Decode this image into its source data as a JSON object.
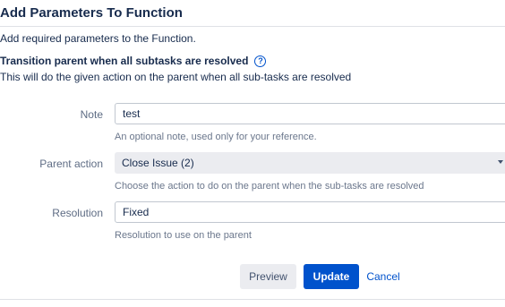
{
  "dialog": {
    "title": "Add Parameters To Function",
    "intro": "Add required parameters to the Function.",
    "section_title": "Transition parent when all subtasks are resolved",
    "help_icon": "question-circle-icon",
    "section_desc": "This will do the given action on the parent when all sub-tasks are resolved"
  },
  "form": {
    "note": {
      "label": "Note",
      "value": "test",
      "hint": "An optional note, used only for your reference."
    },
    "parent_action": {
      "label": "Parent action",
      "value": "Close Issue (2)",
      "hint": "Choose the action to do on the parent when the sub-tasks are resolved"
    },
    "resolution": {
      "label": "Resolution",
      "value": "Fixed",
      "hint": "Resolution to use on the parent"
    }
  },
  "buttons": {
    "preview": "Preview",
    "update": "Update",
    "cancel": "Cancel"
  },
  "colors": {
    "primary": "#0052cc",
    "subtle_bg": "#ebecf0",
    "text": "#172b4d",
    "muted": "#5e6c84"
  }
}
